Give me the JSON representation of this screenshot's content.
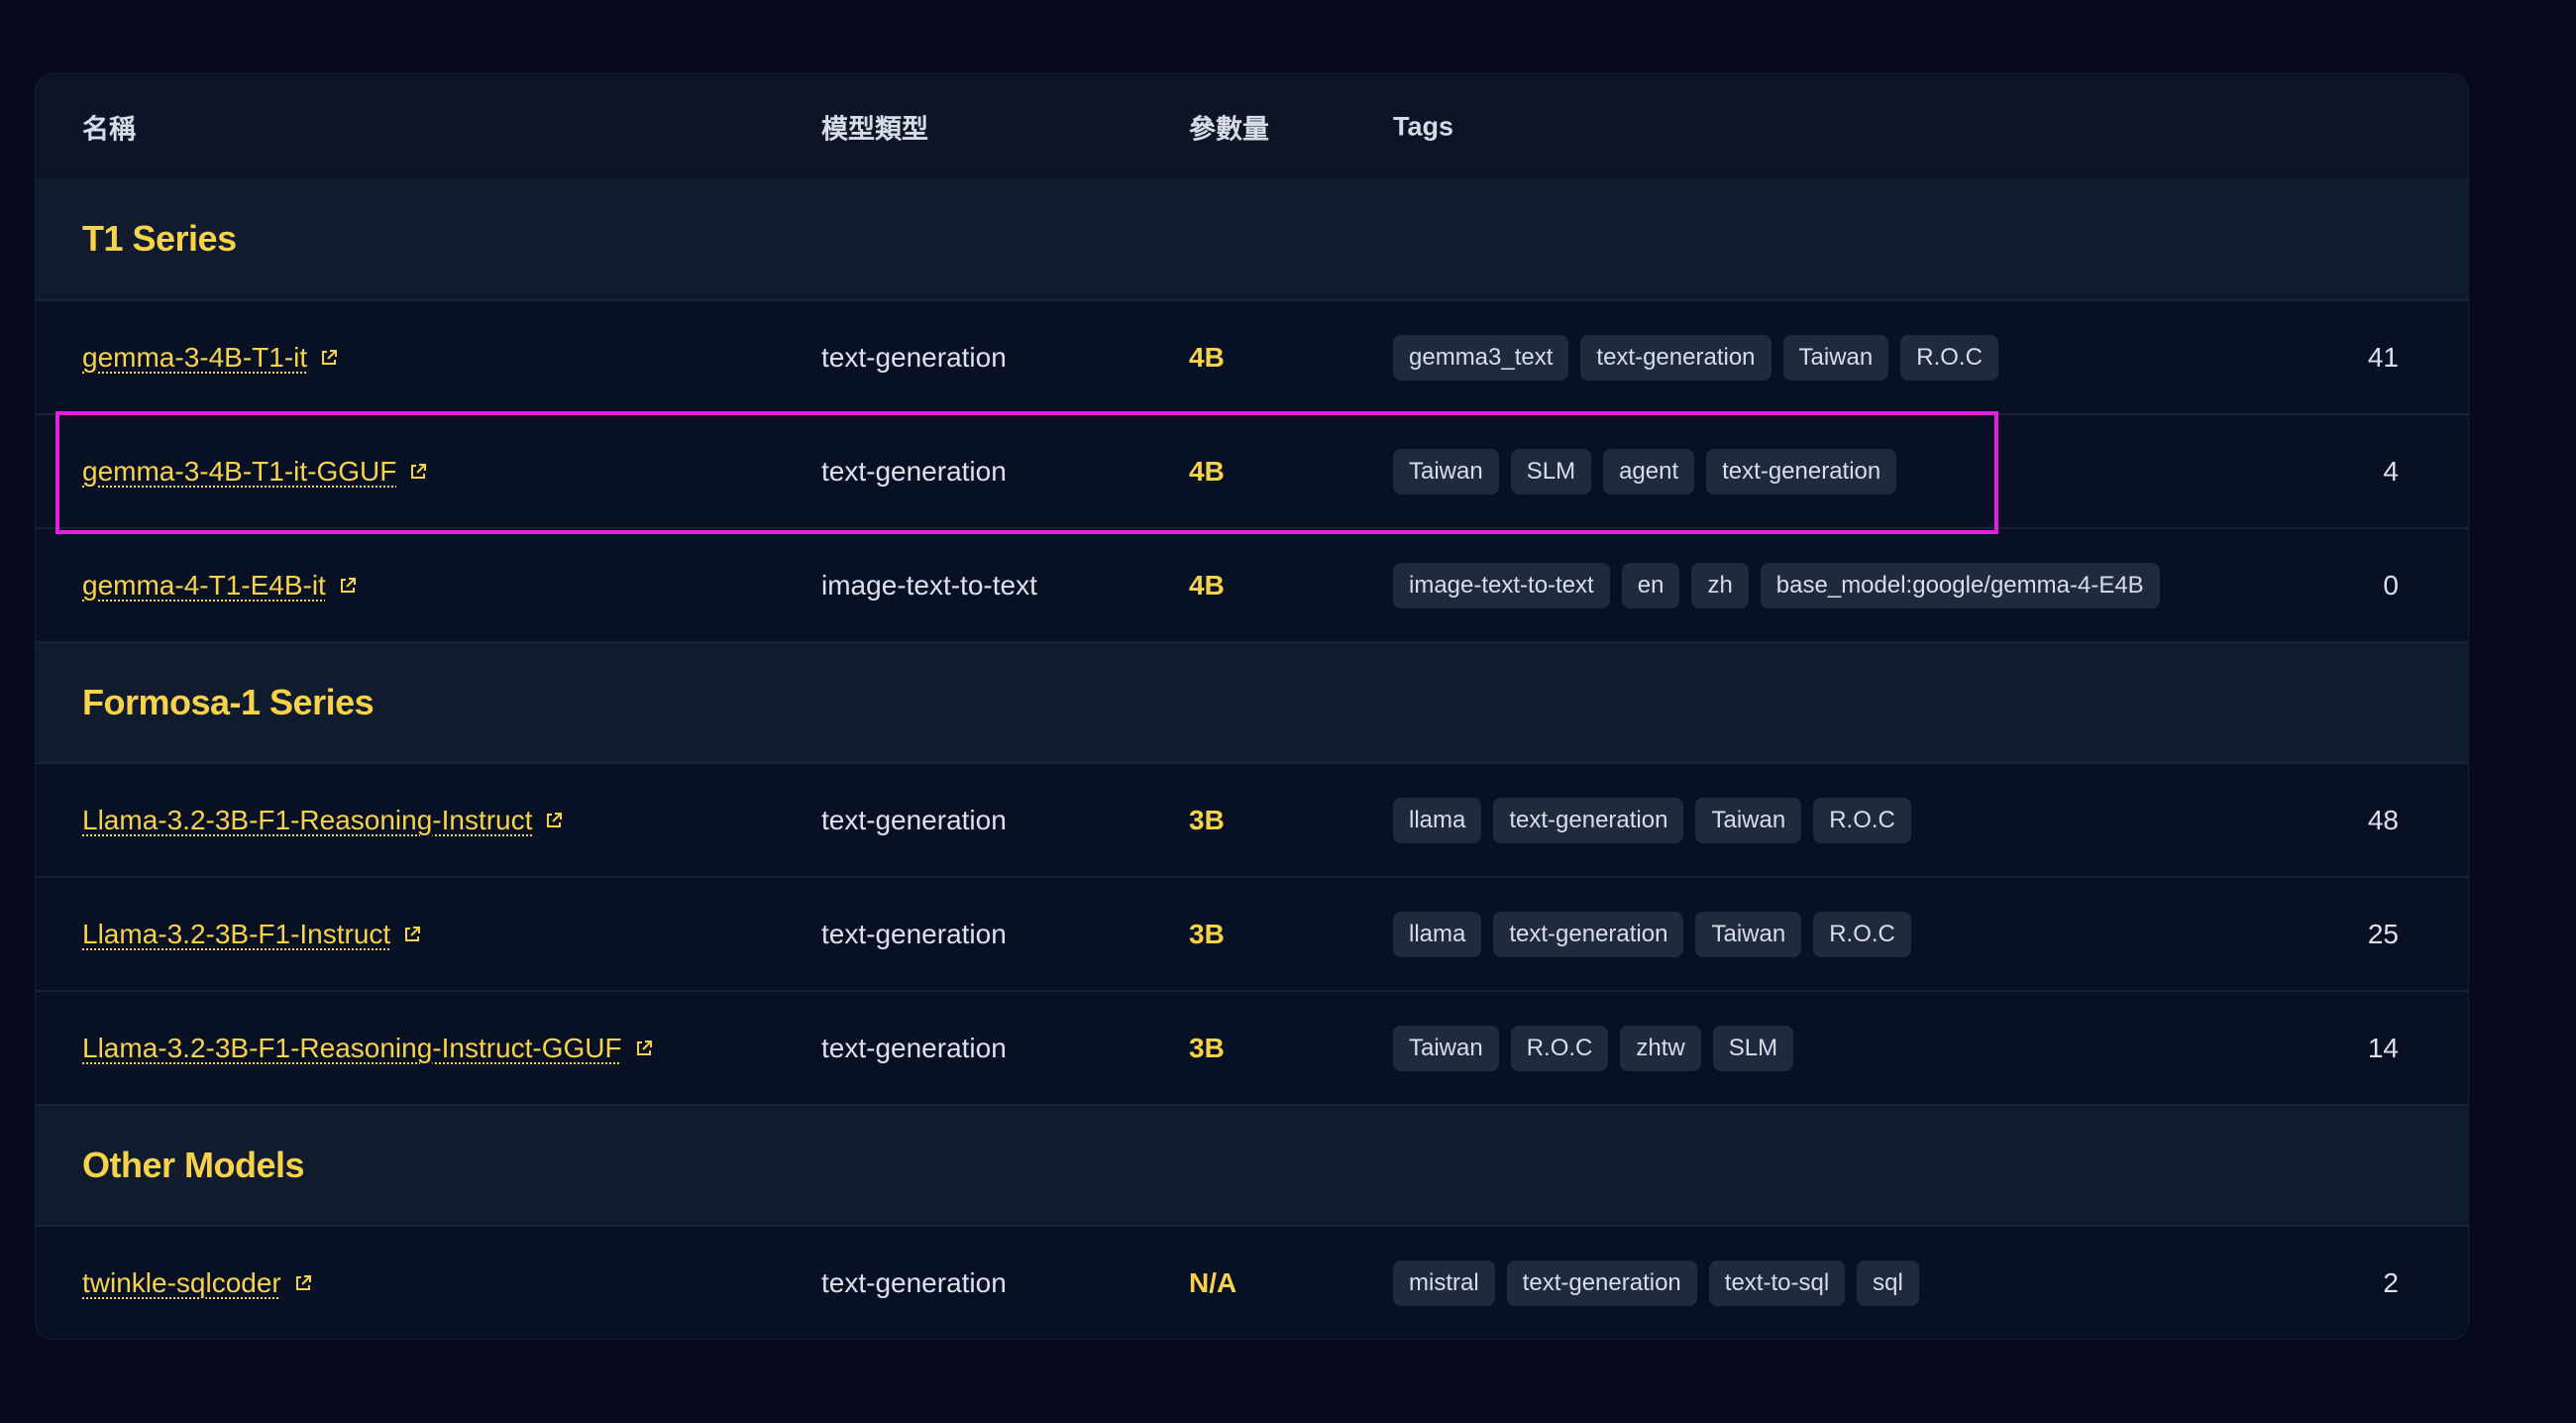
{
  "header": {
    "name": "名稱",
    "type": "模型類型",
    "params": "參數量",
    "tags": "Tags"
  },
  "sections": [
    {
      "title": "T1 Series",
      "rows": [
        {
          "name": "gemma-3-4B-T1-it",
          "type": "text-generation",
          "params": "4B",
          "tags": [
            "gemma3_text",
            "text-generation",
            "Taiwan",
            "R.O.C"
          ],
          "count": "41"
        },
        {
          "name": "gemma-3-4B-T1-it-GGUF",
          "type": "text-generation",
          "params": "4B",
          "tags": [
            "Taiwan",
            "SLM",
            "agent",
            "text-generation"
          ],
          "count": "4"
        },
        {
          "name": "gemma-4-T1-E4B-it",
          "type": "image-text-to-text",
          "params": "4B",
          "tags": [
            "image-text-to-text",
            "en",
            "zh",
            "base_model:google/gemma-4-E4B"
          ],
          "count": "0"
        }
      ]
    },
    {
      "title": "Formosa-1 Series",
      "rows": [
        {
          "name": "Llama-3.2-3B-F1-Reasoning-Instruct",
          "type": "text-generation",
          "params": "3B",
          "tags": [
            "llama",
            "text-generation",
            "Taiwan",
            "R.O.C"
          ],
          "count": "48"
        },
        {
          "name": "Llama-3.2-3B-F1-Instruct",
          "type": "text-generation",
          "params": "3B",
          "tags": [
            "llama",
            "text-generation",
            "Taiwan",
            "R.O.C"
          ],
          "count": "25"
        },
        {
          "name": "Llama-3.2-3B-F1-Reasoning-Instruct-GGUF",
          "type": "text-generation",
          "params": "3B",
          "tags": [
            "Taiwan",
            "R.O.C",
            "zhtw",
            "SLM"
          ],
          "count": "14"
        }
      ]
    },
    {
      "title": "Other Models",
      "rows": [
        {
          "name": "twinkle-sqlcoder",
          "type": "text-generation",
          "params": "N/A",
          "tags": [
            "mistral",
            "text-generation",
            "text-to-sql",
            "sql"
          ],
          "count": "2"
        }
      ]
    }
  ],
  "colors": {
    "page_bg": "#060a1a",
    "accent": "#f8d34a",
    "highlight": "#e51ee0",
    "tag_bg": "#1f2a3d"
  }
}
